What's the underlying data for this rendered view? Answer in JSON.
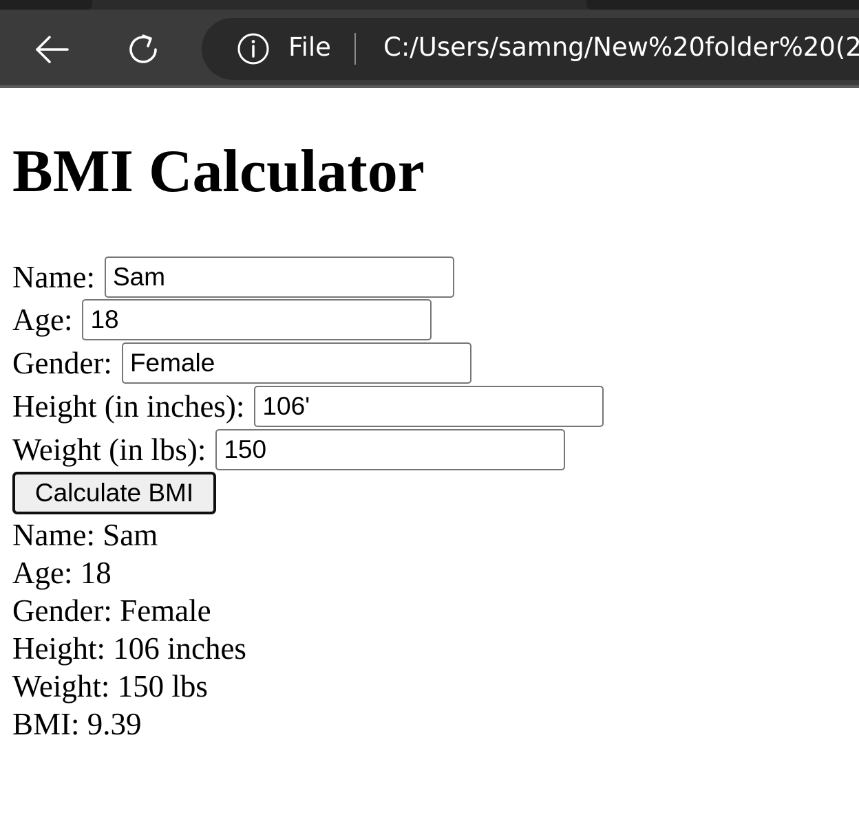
{
  "browser": {
    "address_scheme_label": "File",
    "url": "C:/Users/samng/New%20folder%20(2"
  },
  "page": {
    "title": "BMI Calculator"
  },
  "form": {
    "name_label": "Name:",
    "name_value": "Sam",
    "age_label": "Age:",
    "age_value": "18",
    "gender_label": "Gender:",
    "gender_value": "Female",
    "height_label": "Height (in inches):",
    "height_value": "106'",
    "weight_label": "Weight (in lbs):",
    "weight_value": "150",
    "submit_label": "Calculate BMI"
  },
  "results": [
    "Name: Sam",
    "Age: 18",
    "Gender: Female",
    "Height: 106 inches",
    "Weight: 150 lbs",
    "BMI: 9.39"
  ]
}
